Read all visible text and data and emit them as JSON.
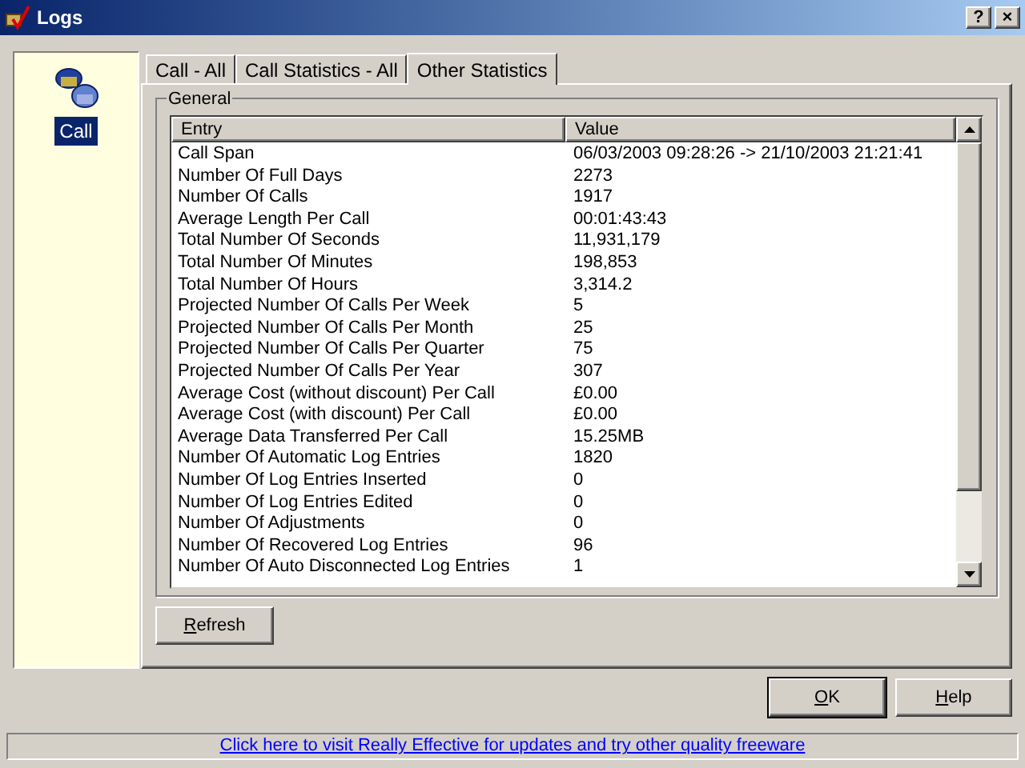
{
  "window": {
    "title": "Logs",
    "buttons": [
      "?",
      "×"
    ]
  },
  "sidebar": {
    "items": [
      {
        "label": "Call",
        "selected": true
      }
    ]
  },
  "tabs": [
    {
      "label": "Call - All",
      "selected": false
    },
    {
      "label": "Call Statistics - All",
      "selected": false
    },
    {
      "label": "Other Statistics",
      "selected": true
    }
  ],
  "group": {
    "title": "General"
  },
  "table": {
    "columns": [
      "Entry",
      "Value"
    ],
    "rows": [
      [
        "Call Span",
        "06/03/2003 09:28:26 -> 21/10/2003 21:21:41"
      ],
      [
        "Number Of Full Days",
        "2273"
      ],
      [
        "Number Of Calls",
        "1917"
      ],
      [
        "Average Length Per Call",
        "00:01:43:43"
      ],
      [
        "Total Number Of Seconds",
        "11,931,179"
      ],
      [
        "Total Number Of Minutes",
        "198,853"
      ],
      [
        "Total Number Of Hours",
        "3,314.2"
      ],
      [
        "Projected Number Of Calls Per Week",
        "5"
      ],
      [
        "Projected Number Of Calls Per Month",
        "25"
      ],
      [
        "Projected Number Of Calls Per Quarter",
        "75"
      ],
      [
        "Projected Number Of Calls Per Year",
        "307"
      ],
      [
        "Average Cost (without discount) Per Call",
        "£0.00"
      ],
      [
        "Average Cost (with discount) Per Call",
        "£0.00"
      ],
      [
        "Average Data Transferred Per Call",
        "15.25MB"
      ],
      [
        "Number Of Automatic Log Entries",
        "1820"
      ],
      [
        "Number Of Log Entries Inserted",
        "0"
      ],
      [
        "Number Of Log Entries Edited",
        "0"
      ],
      [
        "Number Of Adjustments",
        "0"
      ],
      [
        "Number Of Recovered Log Entries",
        "96"
      ],
      [
        "Number Of Auto Disconnected Log Entries",
        "1"
      ]
    ]
  },
  "refresh_button": "Refresh",
  "buttons": [
    {
      "label": "OK",
      "default": true
    },
    {
      "label": "Help",
      "default": false
    }
  ],
  "status_bar": {
    "link": "Click here to visit Really Effective for updates and try other quality freeware"
  }
}
